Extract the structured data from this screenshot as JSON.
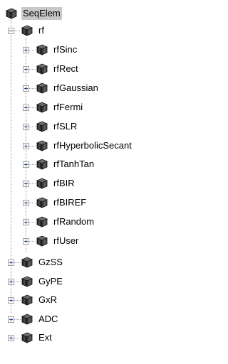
{
  "tree": {
    "root": {
      "label": "SeqElem",
      "selected": true,
      "icon": "cube-icon"
    },
    "rf": {
      "label": "rf",
      "expanded": true,
      "icon": "cube-icon",
      "children": [
        {
          "label": "rfSinc",
          "icon": "cube-icon"
        },
        {
          "label": "rfRect",
          "icon": "cube-icon"
        },
        {
          "label": "rfGaussian",
          "icon": "cube-icon"
        },
        {
          "label": "rfFermi",
          "icon": "cube-icon"
        },
        {
          "label": "rfSLR",
          "icon": "cube-icon"
        },
        {
          "label": "rfHyperbolicSecant",
          "icon": "cube-icon"
        },
        {
          "label": "rfTanhTan",
          "icon": "cube-icon"
        },
        {
          "label": "rfBIR",
          "icon": "cube-icon"
        },
        {
          "label": "rfBIREF",
          "icon": "cube-icon"
        },
        {
          "label": "rfRandom",
          "icon": "cube-icon"
        },
        {
          "label": "rfUser",
          "icon": "cube-icon"
        }
      ]
    },
    "siblings": [
      {
        "label": "GzSS",
        "icon": "cube-icon"
      },
      {
        "label": "GyPE",
        "icon": "cube-icon"
      },
      {
        "label": "GxR",
        "icon": "cube-icon"
      },
      {
        "label": "ADC",
        "icon": "cube-icon"
      },
      {
        "label": "Ext",
        "icon": "cube-icon"
      }
    ]
  },
  "colors": {
    "selection": "#c8c8c8",
    "expander_sign": "#2c4f8c",
    "dotted_line": "#9a9a9a"
  }
}
